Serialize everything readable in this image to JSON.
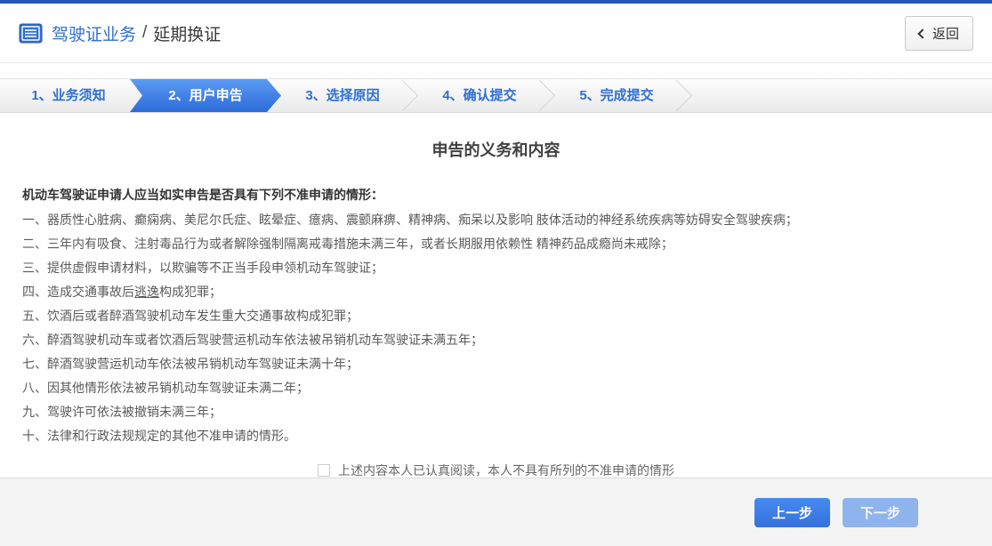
{
  "header": {
    "title_primary": "驾驶证业务",
    "title_separator": "/",
    "title_secondary": "延期换证",
    "back_button_label": "返回"
  },
  "steps": {
    "items": [
      {
        "label": "1、业务须知",
        "active": false,
        "separator": false
      },
      {
        "label": "2、用户申告",
        "active": true,
        "separator": false
      },
      {
        "label": "3、选择原因",
        "active": false,
        "separator": true
      },
      {
        "label": "4、确认提交",
        "active": false,
        "separator": true
      },
      {
        "label": "5、完成提交",
        "active": false,
        "separator": true
      }
    ]
  },
  "main": {
    "title": "申告的义务和内容",
    "lead": "机动车驾驶证申请人应当如实申告是否具有下列不准申请的情形：",
    "items": [
      {
        "text": "一、器质性心脏病、癫痫病、美尼尔氏症、眩晕症、癔病、震颤麻痹、精神病、痴呆以及影响 肢体活动的神经系统疾病等妨碍安全驾驶疾病；"
      },
      {
        "text": "二、三年内有吸食、注射毒品行为或者解除强制隔离戒毒措施未满三年，或者长期服用依赖性 精神药品成瘾尚未戒除；"
      },
      {
        "text": "三、提供虚假申请材料，以欺骗等不正当手段申领机动车驾驶证；"
      },
      {
        "text": "四、造成交通事故后逃逸构成犯罪；",
        "underline": "逃逸"
      },
      {
        "text": "五、饮酒后或者醉酒驾驶机动车发生重大交通事故构成犯罪；"
      },
      {
        "text": "六、醉酒驾驶机动车或者饮酒后驾驶营运机动车依法被吊销机动车驾驶证未满五年；"
      },
      {
        "text": "七、醉酒驾驶营运机动车依法被吊销机动车驾驶证未满十年；"
      },
      {
        "text": "八、因其他情形依法被吊销机动车驾驶证未满二年；"
      },
      {
        "text": "九、驾驶许可依法被撤销未满三年；"
      },
      {
        "text": "十、法律和行政法规规定的其他不准申请的情形。"
      }
    ],
    "confirm": {
      "checked": false,
      "label": "上述内容本人已认真阅读，本人不具有所列的不准申请的情形"
    }
  },
  "footer": {
    "prev_label": "上一步",
    "next_label": "下一步",
    "next_enabled": false
  },
  "colors": {
    "top_bar_blue": "#2458b8",
    "accent_blue": "#2e6fd2",
    "active_step_gradient_top": "#5b9bf3",
    "active_step_gradient_bottom": "#2c6cd9",
    "primary_button_blue": "#3d7ee8",
    "disabled_button_blue": "#8fb3ed",
    "footer_gray": "#f4f4f4"
  }
}
